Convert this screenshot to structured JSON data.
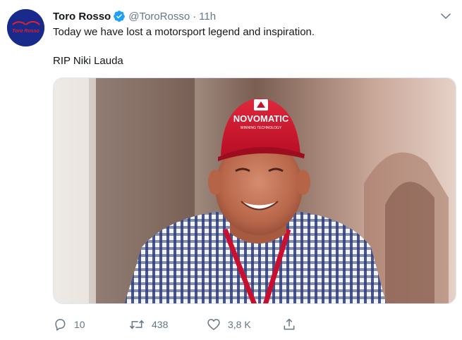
{
  "tweet": {
    "author": {
      "name": "Toro Rosso",
      "handle": "@ToroRosso",
      "verified": true,
      "avatar_text": "Toro Rosso"
    },
    "separator": "·",
    "time": "11h",
    "text_line1": "Today we have lost a motorsport legend and inspiration.",
    "text_line2": "RIP Niki Lauda",
    "media": {
      "cap_brand": "NOVOMATIC",
      "cap_tagline": "WINNING TECHNOLOGY"
    },
    "actions": {
      "replies": "10",
      "retweets": "438",
      "likes": "3,8 K"
    }
  },
  "colors": {
    "text": "#14171a",
    "secondary": "#657786",
    "verified": "#1da1f2",
    "avatar_bg": "#1a2a8c",
    "avatar_accent": "#e0202a",
    "cap_red": "#c8102e"
  },
  "icons": {
    "verified": "verified-badge-icon",
    "caret": "chevron-down-icon",
    "reply": "reply-icon",
    "retweet": "retweet-icon",
    "like": "heart-icon",
    "share": "share-icon"
  }
}
